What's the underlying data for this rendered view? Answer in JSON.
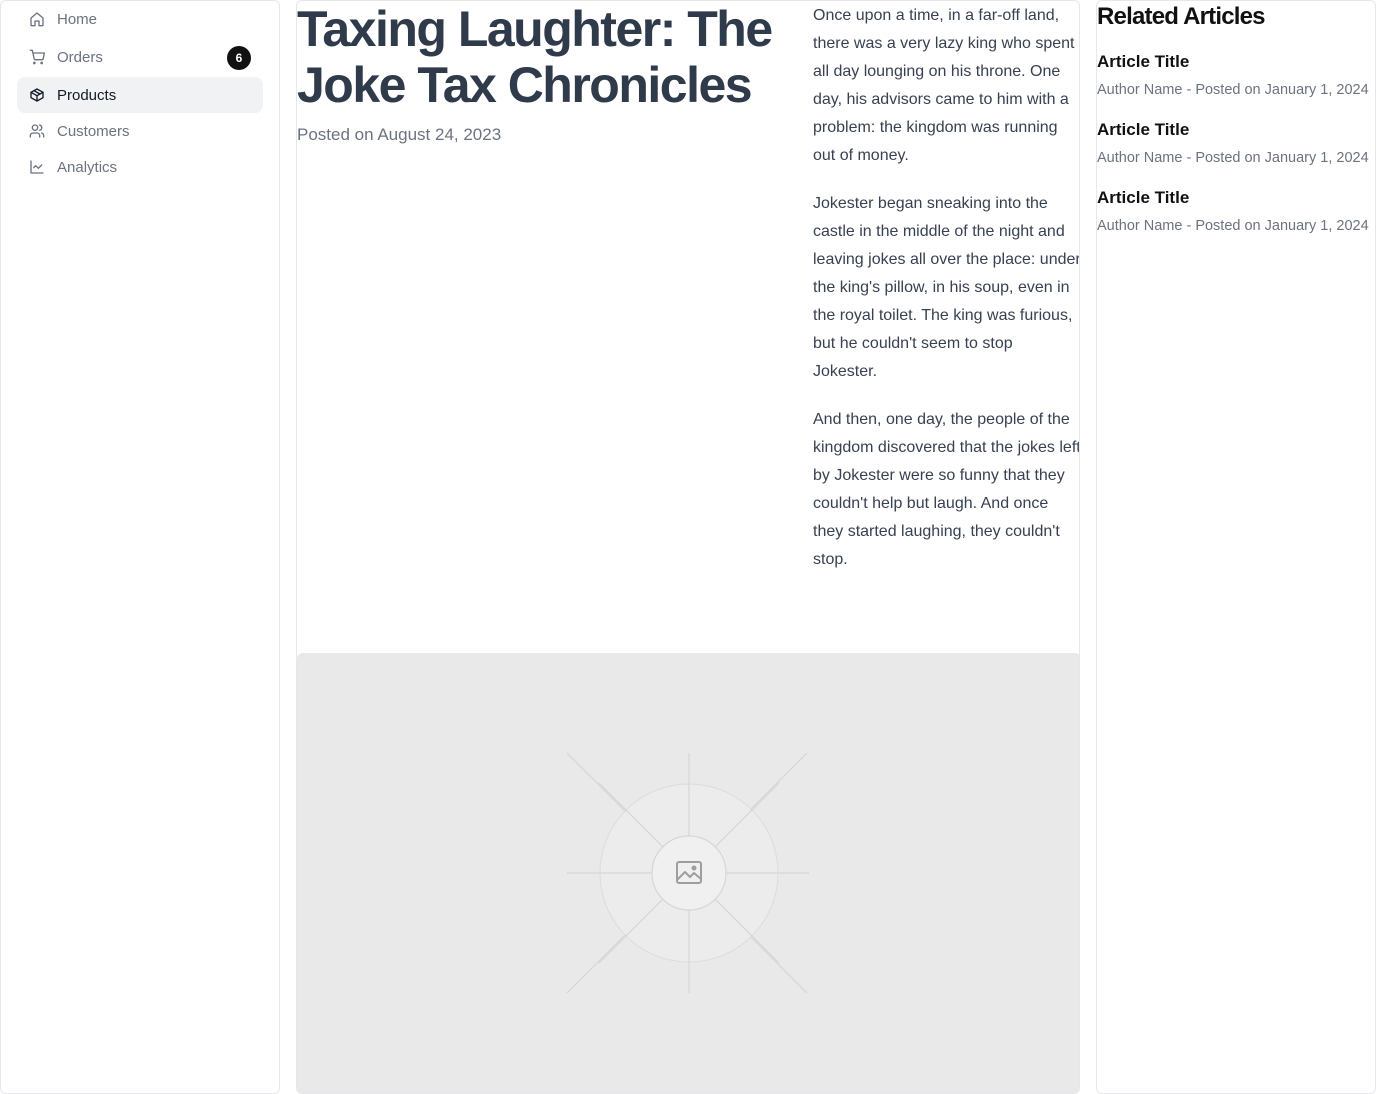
{
  "sidebar": {
    "items": [
      {
        "label": "Home",
        "icon": "home-icon",
        "active": false
      },
      {
        "label": "Orders",
        "icon": "cart-icon",
        "active": false,
        "badge": "6"
      },
      {
        "label": "Products",
        "icon": "package-icon",
        "active": true
      },
      {
        "label": "Customers",
        "icon": "users-icon",
        "active": false
      },
      {
        "label": "Analytics",
        "icon": "line-chart-icon",
        "active": false
      }
    ]
  },
  "article": {
    "title": "Taxing Laughter: The Joke Tax Chronicles",
    "date": "Posted on August 24, 2023",
    "paragraphs": [
      "Once upon a time, in a far-off land, there was a very lazy king who spent all day lounging on his throne. One day, his advisors came to him with a problem: the kingdom was running out of money.",
      "Jokester began sneaking into the castle in the middle of the night and leaving jokes all over the place: under the king's pillow, in his soup, even in the royal toilet. The king was furious, but he couldn't seem to stop Jokester.",
      "And then, one day, the people of the kingdom discovered that the jokes left by Jokester were so funny that they couldn't help but laugh. And once they started laughing, they couldn't stop."
    ],
    "image_icon": "image-placeholder-icon"
  },
  "related": {
    "heading": "Related Articles",
    "items": [
      {
        "title": "Article Title",
        "meta": "Author Name - Posted on January 1, 2024"
      },
      {
        "title": "Article Title",
        "meta": "Author Name - Posted on January 1, 2024"
      },
      {
        "title": "Article Title",
        "meta": "Author Name - Posted on January 1, 2024"
      }
    ]
  },
  "colors": {
    "active_bg": "#f1f2f4",
    "badge_bg": "#111111",
    "title": "#2f3a4a",
    "muted": "#6b7280",
    "placeholder_bg": "#e9e9e9"
  }
}
